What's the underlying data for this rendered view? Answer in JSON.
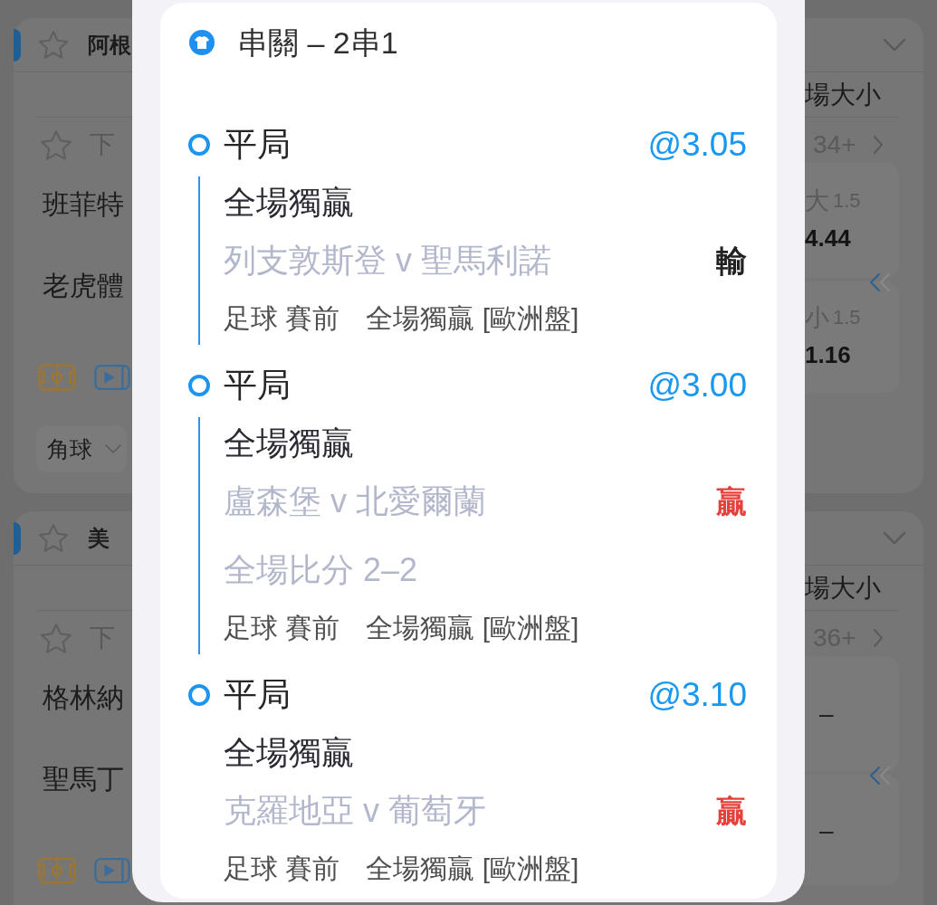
{
  "background_list": {
    "leagues": [
      {
        "name": "阿根",
        "market_header": "場大小",
        "period": "下",
        "more_count": "34+",
        "teams": [
          "班菲特",
          "老虎體"
        ],
        "odds": [
          {
            "label": "大",
            "line": "1.5",
            "price": "4.44"
          },
          {
            "label": "小",
            "line": "1.5",
            "price": "1.16"
          }
        ],
        "filter": "角球"
      },
      {
        "name": "美",
        "market_header": "場大小",
        "period": "下",
        "more_count": "36+",
        "teams": [
          "格林納",
          "聖馬丁"
        ],
        "odds": [
          {
            "price": "–"
          },
          {
            "price": "–"
          }
        ]
      }
    ]
  },
  "bet_slip": {
    "title": "串關 – 2串1",
    "legs": [
      {
        "selection": "平局",
        "odds": "@3.05",
        "market": "全場獨贏",
        "event": "列支敦斯登 v 聖馬利諾",
        "result": {
          "text": "輸",
          "color": "#222222"
        },
        "info": [
          "足球 賽前",
          "全場獨贏 [歐洲盤]"
        ]
      },
      {
        "selection": "平局",
        "odds": "@3.00",
        "market": "全場獨贏",
        "event": "盧森堡 v 北愛爾蘭",
        "result": {
          "text": "贏",
          "color": "#e5403a"
        },
        "score": "全場比分 2–2",
        "info": [
          "足球 賽前",
          "全場獨贏 [歐洲盤]"
        ]
      },
      {
        "selection": "平局",
        "odds": "@3.10",
        "market": "全場獨贏",
        "event": "克羅地亞 v 葡萄牙",
        "result": {
          "text": "贏",
          "color": "#e5403a"
        },
        "info": [
          "足球 賽前",
          "全場獨贏 [歐洲盤]"
        ]
      }
    ]
  }
}
